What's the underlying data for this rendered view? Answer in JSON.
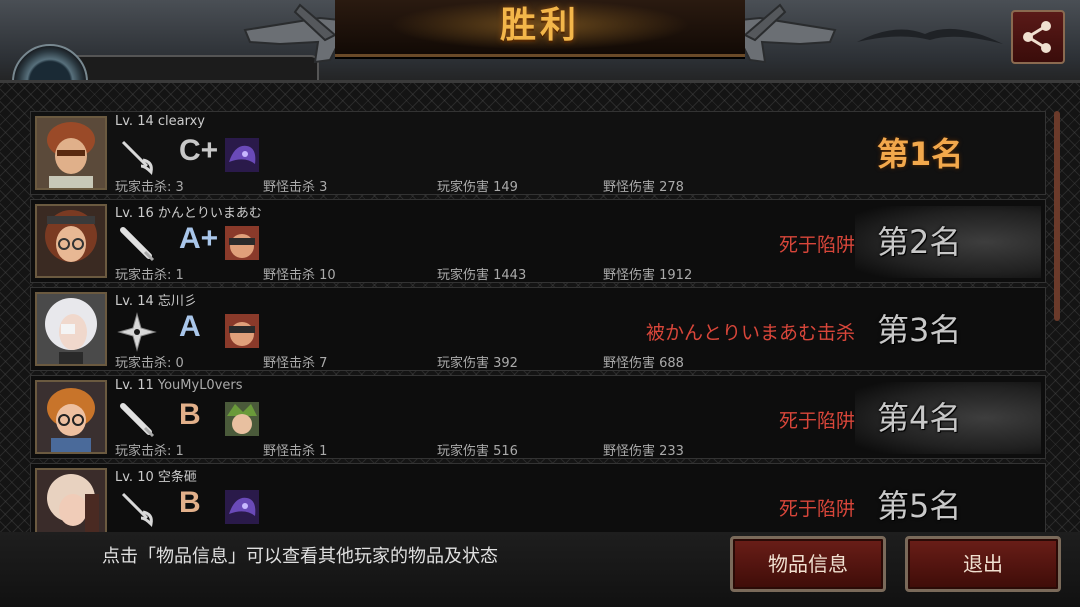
{
  "header": {
    "title": "胜利",
    "share_icon": "share-icon"
  },
  "players": [
    {
      "level": "Lv. 14",
      "name": "clearxy",
      "weapon_icon": "rapier-icon",
      "grade": "C+",
      "grade_color": "#c8c8c8",
      "pet_icon": "purple-creature-icon",
      "player_kills": "玩家击杀: 3",
      "monster_kills": "野怪击杀 3",
      "player_damage": "玩家伤害 149",
      "monster_damage": "野怪伤害 278",
      "death": "",
      "rank": "第1名"
    },
    {
      "level": "Lv. 16",
      "name": "かんとりいまあむ",
      "weapon_icon": "bat-icon",
      "grade": "A+",
      "grade_color": "#a9c6ea",
      "pet_icon": "goggles-portrait-icon",
      "player_kills": "玩家击杀: 1",
      "monster_kills": "野怪击杀 10",
      "player_damage": "玩家伤害 1443",
      "monster_damage": "野怪伤害 1912",
      "death": "死于陷阱",
      "rank": "第2名"
    },
    {
      "level": "Lv. 14",
      "name": "忘川彡",
      "weapon_icon": "shuriken-icon",
      "grade": "A",
      "grade_color": "#a9c6ea",
      "pet_icon": "goggles-portrait-icon",
      "player_kills": "玩家击杀: 0",
      "monster_kills": "野怪击杀 7",
      "player_damage": "玩家伤害 392",
      "monster_damage": "野怪伤害 688",
      "death": "被かんとりいまあむ击杀",
      "rank": "第3名"
    },
    {
      "level": "Lv. 11",
      "name": "YouMyL0vers",
      "weapon_icon": "bat-icon",
      "grade": "B",
      "grade_color": "#e2b08a",
      "pet_icon": "green-hair-portrait-icon",
      "player_kills": "玩家击杀: 1",
      "monster_kills": "野怪击杀 1",
      "player_damage": "玩家伤害 516",
      "monster_damage": "野怪伤害 233",
      "death": "死于陷阱",
      "rank": "第4名"
    },
    {
      "level": "Lv. 10",
      "name": "空条砸",
      "weapon_icon": "rapier-icon",
      "grade": "B",
      "grade_color": "#e2b08a",
      "pet_icon": "purple-creature-icon",
      "player_kills": "",
      "monster_kills": "",
      "player_damage": "",
      "monster_damage": "",
      "death": "死于陷阱",
      "rank": "第5名"
    }
  ],
  "footer": {
    "hint": "点击「物品信息」可以查看其他玩家的物品及状态",
    "items_button": "物品信息",
    "exit_button": "退出"
  }
}
